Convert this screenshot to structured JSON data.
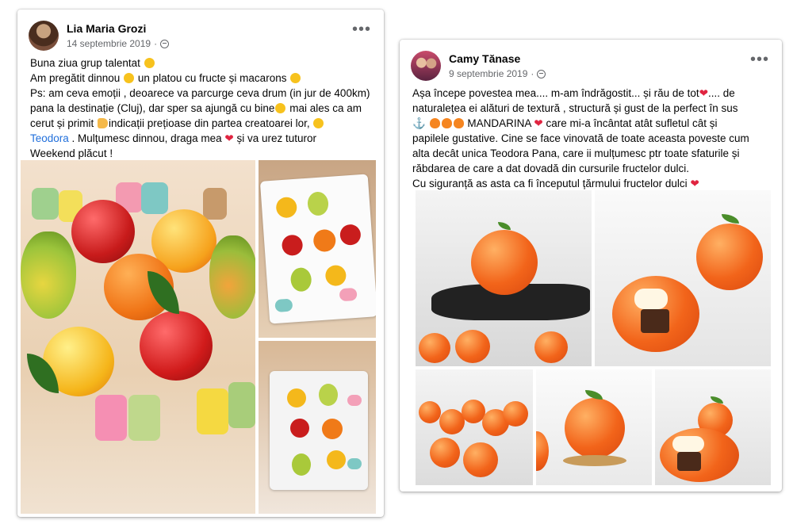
{
  "post1": {
    "author": "Lia Maria Grozi",
    "date": "14 septembrie 2019",
    "privacy_icon": "globe-icon",
    "line1": "Buna ziua grup talentat",
    "line2a": "Am pregătit dinnou",
    "line2b": "un platou cu fructe și macarons",
    "line3a": "Ps: am ceva emoții , deoarece va parcurge ceva drum (in jur de 400km)",
    "line4a": "pana la destinație (Cluj), dar sper sa ajungă cu bine",
    "line4b": "mai ales ca am",
    "line5a": "cerut și primit",
    "line5b": "indicații prețioase din partea creatoarei lor,",
    "mention": "Teodora",
    "line6b": " .  Mulțumesc dinnou, draga mea",
    "line6c": "și va urez tuturor",
    "line7": "Weekend plăcut !"
  },
  "post2": {
    "author": "Camy Tănase",
    "date": "9 septembrie 2019",
    "privacy_icon": "globe-icon",
    "line1a": "Așa începe povestea mea.... m-am îndrăgostit... și rău de tot",
    "line1b": ".... de",
    "line2": "naturalețea ei alături de textură , structură și gust de la perfect în sus",
    "line3": "MANDARINA",
    "line3b": "care mi-a încântat atât sufletul cât și",
    "line4": "papilele gustative. Cine se face vinovată de toate aceasta poveste cum",
    "line5": "alta decât unica Teodora Pana, care ii mulțumesc ptr toate sfaturile și",
    "line6": "răbdarea de care a dat dovadă din cursurile fructelor dulci.",
    "line7": "Cu siguranță as asta ca fi începutul țărmului fructelor dulci"
  },
  "colors": {
    "mention": "#216fdb",
    "heart": "#e02440",
    "meta": "#65676b"
  }
}
